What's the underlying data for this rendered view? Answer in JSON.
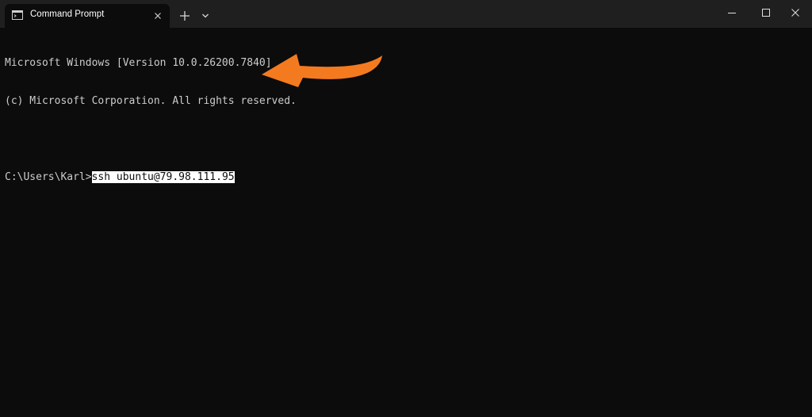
{
  "window": {
    "tab_title": "Command Prompt",
    "icons": {
      "tab": "console-icon",
      "close_tab": "close-icon",
      "new_tab": "plus-icon",
      "dropdown": "chevron-down-icon",
      "minimize": "minimize-icon",
      "maximize": "maximize-icon",
      "close": "close-icon"
    }
  },
  "console": {
    "line1": "Microsoft Windows [Version 10.0.26200.7840]",
    "line2": "(c) Microsoft Corporation. All rights reserved.",
    "prompt": "C:\\Users\\Karl>",
    "command": "ssh ubuntu@79.98.111.95"
  },
  "annotation": {
    "arrow_color": "#f47a20"
  },
  "colors": {
    "background": "#0c0c0c",
    "titlebar": "#1f1f1f",
    "text": "#cccccc",
    "selection": "#ffffff"
  }
}
